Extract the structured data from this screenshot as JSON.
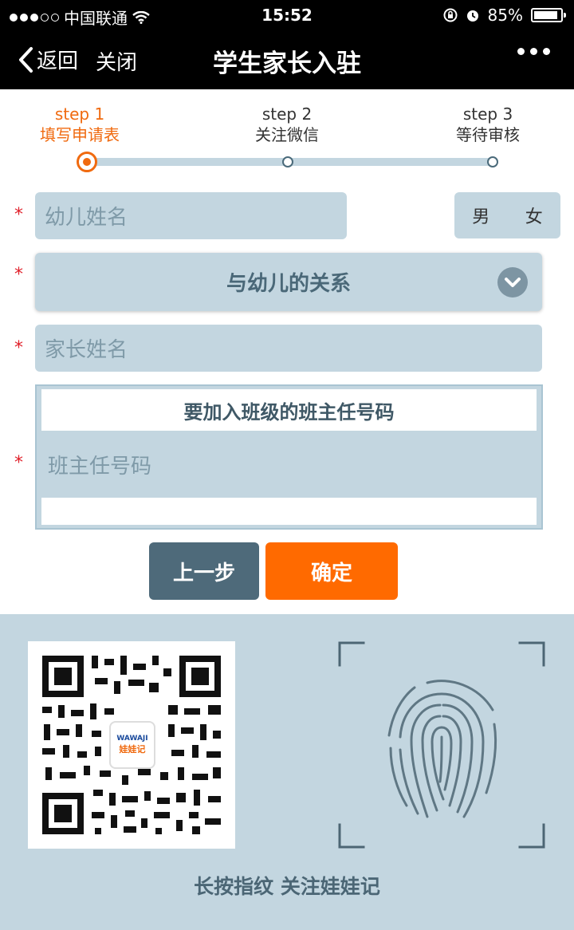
{
  "status": {
    "carrier": "中国联通",
    "time": "15:52",
    "battery": "85%",
    "signal_bars": 3
  },
  "nav": {
    "back": "返回",
    "close": "关闭",
    "title": "学生家长入驻"
  },
  "steps": [
    {
      "step": "step 1",
      "label": "填写申请表"
    },
    {
      "step": "step 2",
      "label": "关注微信"
    },
    {
      "step": "step 3",
      "label": "等待审核"
    }
  ],
  "form": {
    "required_mark": "*",
    "child_name_placeholder": "幼儿姓名",
    "gender_male": "男",
    "gender_female": "女",
    "relation_select": "与幼儿的关系",
    "parent_name_placeholder": "家长姓名",
    "teacher_section_title": "要加入班级的班主任号码",
    "teacher_phone_placeholder": "班主任号码"
  },
  "buttons": {
    "prev": "上一步",
    "confirm": "确定"
  },
  "bottom": {
    "qr_logo_top": "WAWAJI",
    "qr_logo_bottom": "娃娃记",
    "hint": "长按指纹 关注娃娃记"
  },
  "colors": {
    "accent": "#ff6a00",
    "field_bg": "#c3d6e0",
    "dark_button": "#4e6a7a",
    "required": "#e0202a"
  }
}
